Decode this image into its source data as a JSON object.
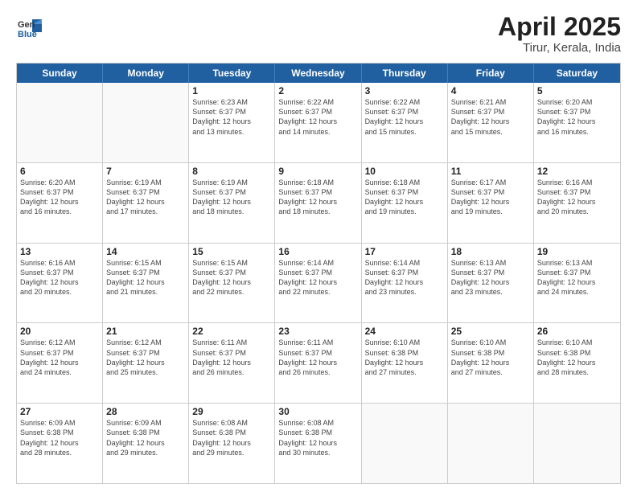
{
  "header": {
    "logo_general": "General",
    "logo_blue": "Blue",
    "month_title": "April 2025",
    "location": "Tirur, Kerala, India"
  },
  "weekdays": [
    "Sunday",
    "Monday",
    "Tuesday",
    "Wednesday",
    "Thursday",
    "Friday",
    "Saturday"
  ],
  "rows": [
    [
      {
        "day": "",
        "info": ""
      },
      {
        "day": "",
        "info": ""
      },
      {
        "day": "1",
        "info": "Sunrise: 6:23 AM\nSunset: 6:37 PM\nDaylight: 12 hours\nand 13 minutes."
      },
      {
        "day": "2",
        "info": "Sunrise: 6:22 AM\nSunset: 6:37 PM\nDaylight: 12 hours\nand 14 minutes."
      },
      {
        "day": "3",
        "info": "Sunrise: 6:22 AM\nSunset: 6:37 PM\nDaylight: 12 hours\nand 15 minutes."
      },
      {
        "day": "4",
        "info": "Sunrise: 6:21 AM\nSunset: 6:37 PM\nDaylight: 12 hours\nand 15 minutes."
      },
      {
        "day": "5",
        "info": "Sunrise: 6:20 AM\nSunset: 6:37 PM\nDaylight: 12 hours\nand 16 minutes."
      }
    ],
    [
      {
        "day": "6",
        "info": "Sunrise: 6:20 AM\nSunset: 6:37 PM\nDaylight: 12 hours\nand 16 minutes."
      },
      {
        "day": "7",
        "info": "Sunrise: 6:19 AM\nSunset: 6:37 PM\nDaylight: 12 hours\nand 17 minutes."
      },
      {
        "day": "8",
        "info": "Sunrise: 6:19 AM\nSunset: 6:37 PM\nDaylight: 12 hours\nand 18 minutes."
      },
      {
        "day": "9",
        "info": "Sunrise: 6:18 AM\nSunset: 6:37 PM\nDaylight: 12 hours\nand 18 minutes."
      },
      {
        "day": "10",
        "info": "Sunrise: 6:18 AM\nSunset: 6:37 PM\nDaylight: 12 hours\nand 19 minutes."
      },
      {
        "day": "11",
        "info": "Sunrise: 6:17 AM\nSunset: 6:37 PM\nDaylight: 12 hours\nand 19 minutes."
      },
      {
        "day": "12",
        "info": "Sunrise: 6:16 AM\nSunset: 6:37 PM\nDaylight: 12 hours\nand 20 minutes."
      }
    ],
    [
      {
        "day": "13",
        "info": "Sunrise: 6:16 AM\nSunset: 6:37 PM\nDaylight: 12 hours\nand 20 minutes."
      },
      {
        "day": "14",
        "info": "Sunrise: 6:15 AM\nSunset: 6:37 PM\nDaylight: 12 hours\nand 21 minutes."
      },
      {
        "day": "15",
        "info": "Sunrise: 6:15 AM\nSunset: 6:37 PM\nDaylight: 12 hours\nand 22 minutes."
      },
      {
        "day": "16",
        "info": "Sunrise: 6:14 AM\nSunset: 6:37 PM\nDaylight: 12 hours\nand 22 minutes."
      },
      {
        "day": "17",
        "info": "Sunrise: 6:14 AM\nSunset: 6:37 PM\nDaylight: 12 hours\nand 23 minutes."
      },
      {
        "day": "18",
        "info": "Sunrise: 6:13 AM\nSunset: 6:37 PM\nDaylight: 12 hours\nand 23 minutes."
      },
      {
        "day": "19",
        "info": "Sunrise: 6:13 AM\nSunset: 6:37 PM\nDaylight: 12 hours\nand 24 minutes."
      }
    ],
    [
      {
        "day": "20",
        "info": "Sunrise: 6:12 AM\nSunset: 6:37 PM\nDaylight: 12 hours\nand 24 minutes."
      },
      {
        "day": "21",
        "info": "Sunrise: 6:12 AM\nSunset: 6:37 PM\nDaylight: 12 hours\nand 25 minutes."
      },
      {
        "day": "22",
        "info": "Sunrise: 6:11 AM\nSunset: 6:37 PM\nDaylight: 12 hours\nand 26 minutes."
      },
      {
        "day": "23",
        "info": "Sunrise: 6:11 AM\nSunset: 6:37 PM\nDaylight: 12 hours\nand 26 minutes."
      },
      {
        "day": "24",
        "info": "Sunrise: 6:10 AM\nSunset: 6:38 PM\nDaylight: 12 hours\nand 27 minutes."
      },
      {
        "day": "25",
        "info": "Sunrise: 6:10 AM\nSunset: 6:38 PM\nDaylight: 12 hours\nand 27 minutes."
      },
      {
        "day": "26",
        "info": "Sunrise: 6:10 AM\nSunset: 6:38 PM\nDaylight: 12 hours\nand 28 minutes."
      }
    ],
    [
      {
        "day": "27",
        "info": "Sunrise: 6:09 AM\nSunset: 6:38 PM\nDaylight: 12 hours\nand 28 minutes."
      },
      {
        "day": "28",
        "info": "Sunrise: 6:09 AM\nSunset: 6:38 PM\nDaylight: 12 hours\nand 29 minutes."
      },
      {
        "day": "29",
        "info": "Sunrise: 6:08 AM\nSunset: 6:38 PM\nDaylight: 12 hours\nand 29 minutes."
      },
      {
        "day": "30",
        "info": "Sunrise: 6:08 AM\nSunset: 6:38 PM\nDaylight: 12 hours\nand 30 minutes."
      },
      {
        "day": "",
        "info": ""
      },
      {
        "day": "",
        "info": ""
      },
      {
        "day": "",
        "info": ""
      }
    ]
  ]
}
